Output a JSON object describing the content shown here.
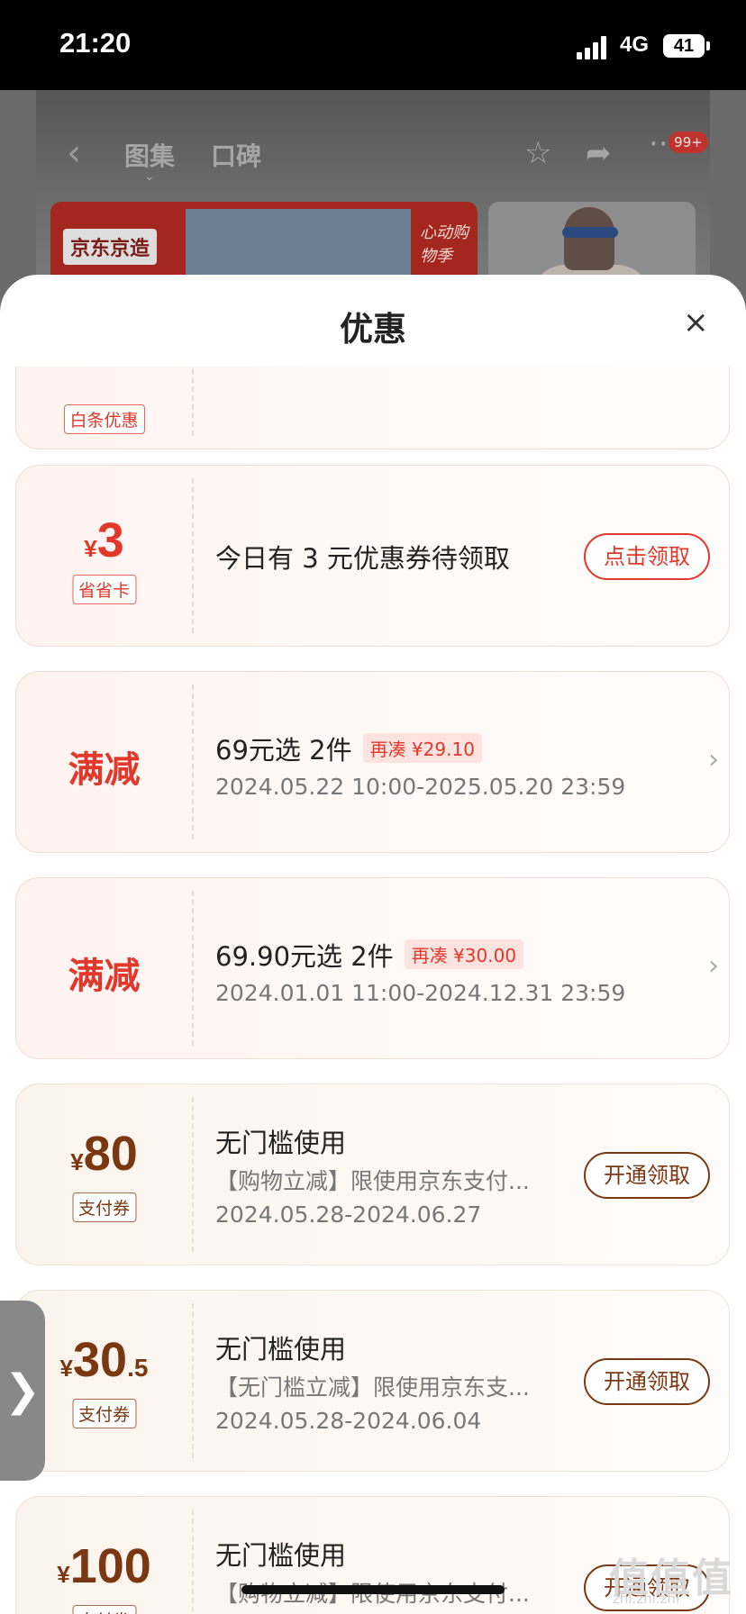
{
  "status": {
    "time": "21:20",
    "network": "4G",
    "battery": "41"
  },
  "header": {
    "tabs": [
      {
        "label": "图集"
      },
      {
        "label": "口碑"
      }
    ],
    "badge": "99+",
    "banner_logo": "京东京造",
    "banner_tag": "心动购物季"
  },
  "sheet": {
    "title": "优惠",
    "close": "×"
  },
  "coupons": [
    {
      "tag": "白条优惠"
    },
    {
      "currency": "¥",
      "amount": "3",
      "tag": "省省卡",
      "text": "今日有 3 元优惠券待领取",
      "button": "点击领取"
    },
    {
      "badge_text": "满减",
      "title": "69元选 2件",
      "pill": "再凑 ¥29.10",
      "period": "2024.05.22 10:00-2025.05.20 23:59"
    },
    {
      "badge_text": "满减",
      "title": "69.90元选 2件",
      "pill": "再凑 ¥30.00",
      "period": "2024.01.01 11:00-2024.12.31 23:59"
    },
    {
      "currency": "¥",
      "amount": "80",
      "tag": "支付券",
      "title": "无门槛使用",
      "desc": "【购物立减】限使用京东支付...",
      "period": "2024.05.28-2024.06.27",
      "button": "开通领取"
    },
    {
      "currency": "¥",
      "amount": "30",
      "amount_frac": ".5",
      "tag": "支付券",
      "title": "无门槛使用",
      "desc": "【无门槛立减】限使用京东支...",
      "period": "2024.05.28-2024.06.04",
      "button": "开通领取"
    },
    {
      "currency": "¥",
      "amount": "100",
      "tag": "支付券",
      "title": "无门槛使用",
      "desc": "【购物立减】限使用京东支付...",
      "button": "开通领取"
    }
  ],
  "watermark": {
    "main": "值值值",
    "sub": "zhi.zhi.zhi"
  },
  "colors": {
    "accent_red": "#e2372b",
    "brown": "#7a3812"
  }
}
